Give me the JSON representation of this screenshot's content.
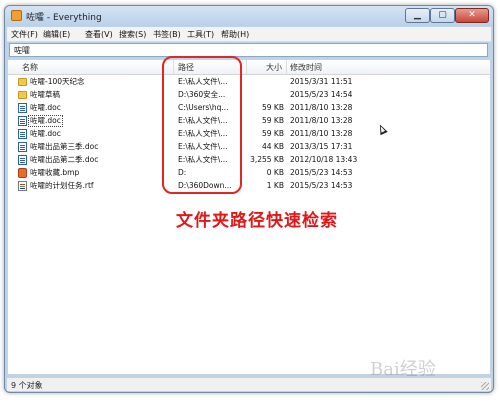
{
  "window": {
    "title": "咗嚯 - Everything",
    "controls": {
      "minimize": "▁",
      "maximize": "▢",
      "close": "✕"
    }
  },
  "menu": [
    "文件(F)",
    "编辑(E)",
    "查看(V)",
    "搜索(S)",
    "书签(B)",
    "工具(T)",
    "帮助(H)"
  ],
  "search": {
    "value": "咗嚯"
  },
  "columns": {
    "name": "名称",
    "path": "路径",
    "size": "大小",
    "modified": "修改时间"
  },
  "rows": [
    {
      "icon": "folder-icon",
      "name": "咗嚯-100天纪念",
      "path": "E:\\私人文件\\...",
      "size": "",
      "modified": "2015/3/31 11:51"
    },
    {
      "icon": "folder-icon",
      "name": "咗嚯草稿",
      "path": "D:\\360安全...",
      "size": "",
      "modified": "2015/5/23 14:54"
    },
    {
      "icon": "doc-icon",
      "name": "咗嚯.doc",
      "path": "C:\\Users\\hq...",
      "size": "59 KB",
      "modified": "2011/8/10 13:28"
    },
    {
      "icon": "doc-icon",
      "name": "咗嚯.doc",
      "path": "E:\\私人文件\\...",
      "size": "59 KB",
      "modified": "2011/8/10 13:28"
    },
    {
      "icon": "doc-icon",
      "name": "咗嚯.doc",
      "path": "E:\\私人文件\\...",
      "size": "59 KB",
      "modified": "2011/8/10 13:28"
    },
    {
      "icon": "doc-icon",
      "name": "咗嚯出品第三季.doc",
      "path": "E:\\私人文件\\...",
      "size": "44 KB",
      "modified": "2013/3/15 17:31"
    },
    {
      "icon": "doc-icon",
      "name": "咗嚯出品第二季.doc",
      "path": "E:\\私人文件\\...",
      "size": "3,255 KB",
      "modified": "2012/10/18 13:43"
    },
    {
      "icon": "bmp-icon",
      "name": "咗嚯收藏.bmp",
      "path": "D:",
      "size": "0 KB",
      "modified": "2015/5/23 14:53"
    },
    {
      "icon": "rtf-icon",
      "name": "咗嚯的计划任务.rtf",
      "path": "D:\\360Down...",
      "size": "1 KB",
      "modified": "2015/5/23 14:53"
    }
  ],
  "annotation": "文件夹路径快速检索",
  "status": "9 个对象",
  "watermark": "Bai经验"
}
